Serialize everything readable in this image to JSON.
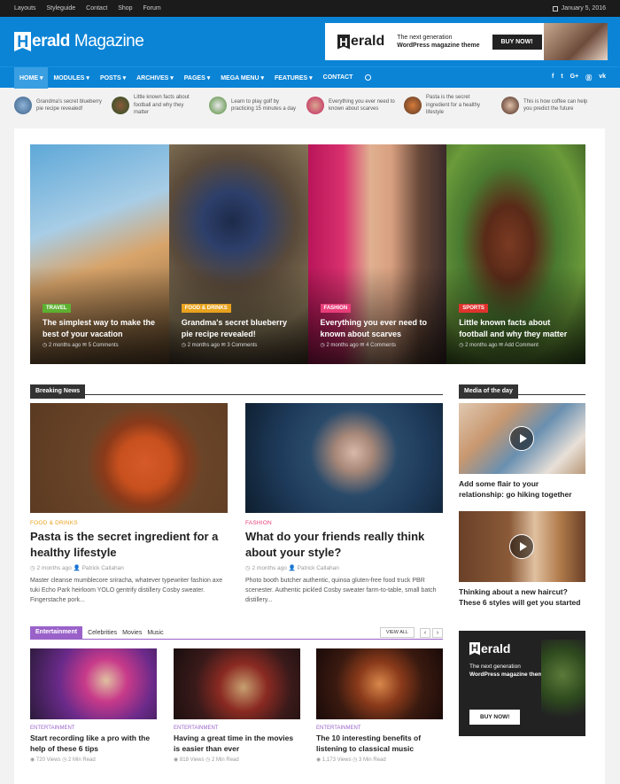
{
  "topbar": {
    "links": [
      "Layouts",
      "Styleguide",
      "Contact",
      "Shop",
      "Forum"
    ],
    "date": "January 5, 2016"
  },
  "header": {
    "logo_main": "Herald",
    "logo_h": "H",
    "logo_rest": "erald",
    "logo_sub": "Magazine",
    "banner": {
      "logo_h": "H",
      "logo_rest": "erald",
      "line1": "The next generation",
      "line2": "WordPress magazine theme",
      "button": "BUY NOW!"
    }
  },
  "nav": {
    "items": [
      "HOME ▾",
      "MODULES ▾",
      "POSTS ▾",
      "ARCHIVES ▾",
      "PAGES ▾",
      "MEGA MENU ▾",
      "FEATURES ▾",
      "CONTACT"
    ],
    "social": [
      "f",
      "t",
      "G+",
      "Ⓑ",
      "vk"
    ]
  },
  "ticker": [
    "Grandma's secret blueberry pie recipe revealed!",
    "Little known facts about football and why they matter",
    "Learn to play golf by practicing 15 minutes a day",
    "Everything you ever need to known about scarves",
    "Pasta is the secret ingredient for a healthy lifestyle",
    "This is how coffee can help you predict the future"
  ],
  "hero": [
    {
      "cat": "TRAVEL",
      "color": "#5eb031",
      "title": "The simplest way to make the best of your vacation",
      "meta": "◷ 2 months ago  ✉ 5 Comments"
    },
    {
      "cat": "FOOD & DRINKS",
      "color": "#e8a21e",
      "title": "Grandma's secret blueberry pie recipe revealed!",
      "meta": "◷ 2 months ago  ✉ 3 Comments"
    },
    {
      "cat": "FASHION",
      "color": "#e83e7a",
      "title": "Everything you ever need to known about scarves",
      "meta": "◷ 2 months ago  ✉ 4 Comments"
    },
    {
      "cat": "SPORTS",
      "color": "#e0332e",
      "title": "Little known facts about football and why they matter",
      "meta": "◷ 2 months ago  ✉ Add Comment"
    }
  ],
  "breaking": {
    "heading": "Breaking News",
    "posts": [
      {
        "cat": "FOOD & DRINKS",
        "title": "Pasta is the secret ingredient for a healthy lifestyle",
        "meta": "◷ 2 months ago   👤 Patrick Callahan",
        "excerpt": "Master cleanse mumblecore sriracha, whatever typewriter fashion axe tuki Echo Park heirloom YOLO gentrify distillery Cosby sweater. Fingerstache pork..."
      },
      {
        "cat": "FASHION",
        "title": "What do your friends really think about your style?",
        "meta": "◷ 2 months ago   👤 Patrick Callahan",
        "excerpt": "Photo booth butcher authentic, quinoa gluten-free food truck PBR scenester. Authentic pickled Cosby sweater farm-to-table, small batch distillery..."
      }
    ]
  },
  "media": {
    "heading": "Media of the day",
    "items": [
      {
        "title": "Add some flair to your relationship: go hiking together"
      },
      {
        "title": "Thinking about a new haircut? These 6 styles will get you started"
      }
    ]
  },
  "entertainment": {
    "heading": "Entertainment",
    "subtabs": [
      "Celebrities",
      "Movies",
      "Music"
    ],
    "view_all": "VIEW ALL",
    "posts": [
      {
        "cat": "ENTERTAINMENT",
        "title": "Start recording like a pro with the help of these 6 tips",
        "meta": "◉ 720 Views   ◷ 2 Min Read"
      },
      {
        "cat": "ENTERTAINMENT",
        "title": "Having a great time in the movies is easier than ever",
        "meta": "◉ 818 Views   ◷ 2 Min Read"
      },
      {
        "cat": "ENTERTAINMENT",
        "title": "The 10 interesting benefits of listening to classical music",
        "meta": "◉ 1,173 Views   ◷ 3 Min Read"
      }
    ]
  },
  "ad": {
    "logo_h": "H",
    "logo_rest": "erald",
    "line1": "The next generation",
    "line2": "WordPress magazine theme",
    "button": "BUY NOW!"
  }
}
